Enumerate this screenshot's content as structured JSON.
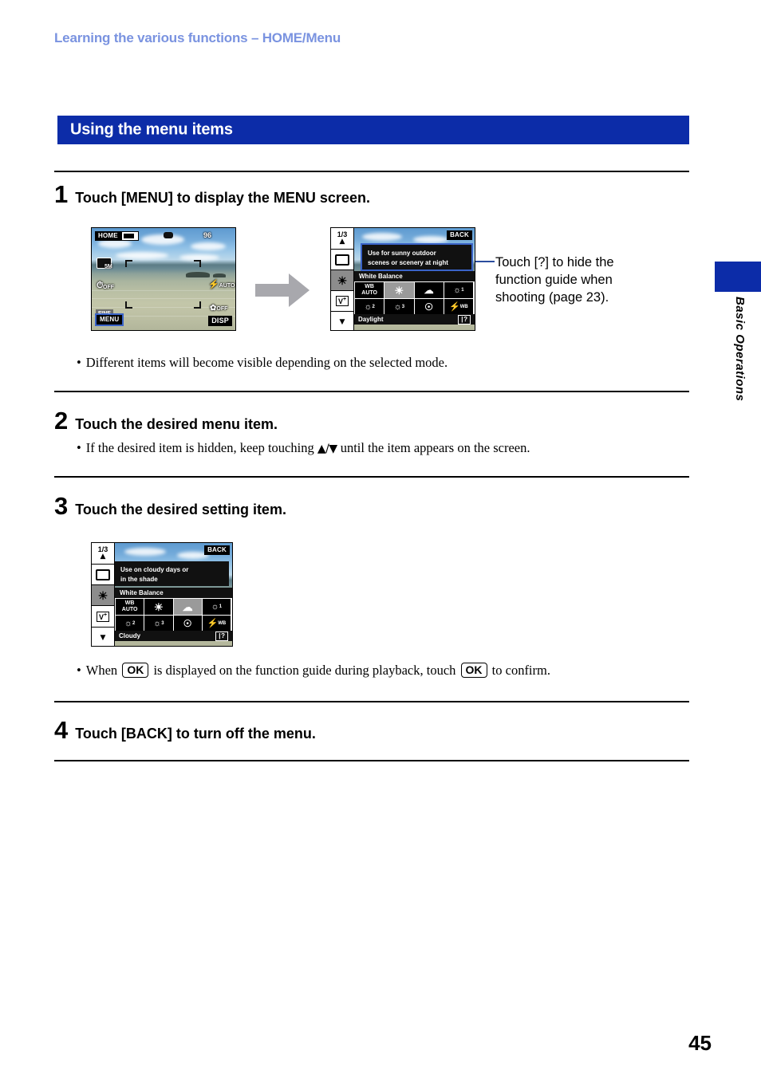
{
  "header": {
    "running_title": "Learning the various functions – HOME/Menu"
  },
  "section": {
    "title": "Using the menu items"
  },
  "steps": [
    {
      "num": "1",
      "text": "Touch [MENU] to display the MENU screen."
    },
    {
      "num": "2",
      "text": "Touch the desired menu item."
    },
    {
      "num": "3",
      "text": "Touch the desired setting item."
    },
    {
      "num": "4",
      "text": "Touch [BACK] to turn off the menu."
    }
  ],
  "bullets": {
    "step1": "Different items will become visible depending on the selected mode.",
    "step2_a": "If the desired item is hidden, keep touching ",
    "step2_arrows": "▲/▼",
    "step2_b": " until the item appears on the screen.",
    "step3_a": "When ",
    "step3_ok1": "OK",
    "step3_b": " is displayed on the function guide during playback, touch ",
    "step3_ok2": "OK",
    "step3_c": " to confirm."
  },
  "callout": {
    "line1": "Touch [?] to hide the",
    "line2": "function guide when",
    "line3": "shooting (page 23)."
  },
  "screen_shooting": {
    "home_label": "HOME",
    "battery_label": "",
    "image_size": "5M",
    "shots_remaining": "96",
    "selftimer": "OFF",
    "quality": "FINE",
    "flash_mode": "AUTO",
    "macro_mode": "OFF",
    "menu_label": "MENU",
    "disp_label": "DISP"
  },
  "screen_menu_daylight": {
    "page_indicator": "1/3",
    "up_arrow": "▲",
    "down_arrow": "▼",
    "back_label": "BACK",
    "rail_items": [
      "screen-icon",
      "white-balance-icon",
      "ev-icon"
    ],
    "guide_line1": "Use for sunny outdoor",
    "guide_line2": "scenes or scenery at night",
    "menu_title": "White Balance",
    "options": [
      {
        "label": "WB\nAUTO",
        "name": "wb-auto",
        "selected": false
      },
      {
        "label": "",
        "name": "daylight",
        "selected": true
      },
      {
        "label": "",
        "name": "cloudy",
        "selected": false
      },
      {
        "label": "1",
        "name": "fluorescent-1",
        "selected": false
      },
      {
        "label": "2",
        "name": "fluorescent-2",
        "selected": false
      },
      {
        "label": "3",
        "name": "fluorescent-3",
        "selected": false
      },
      {
        "label": "",
        "name": "incandescent",
        "selected": false
      },
      {
        "label": "WB",
        "name": "flash",
        "selected": false
      }
    ],
    "status_label": "Daylight",
    "help_label": "?"
  },
  "screen_menu_cloudy": {
    "page_indicator": "1/3",
    "up_arrow": "▲",
    "down_arrow": "▼",
    "back_label": "BACK",
    "guide_line1": "Use on cloudy days or",
    "guide_line2": "in the shade",
    "menu_title": "White Balance",
    "status_label": "Cloudy",
    "help_label": "?"
  },
  "sidebar": {
    "chapter_label": "Basic Operations"
  },
  "footer": {
    "page_number": "45"
  },
  "colors": {
    "header_blue": "#7a93e0",
    "section_navy": "#0c2ca8",
    "highlight_blue": "#3a63c8",
    "arrow_gray": "#a8a8ad"
  }
}
